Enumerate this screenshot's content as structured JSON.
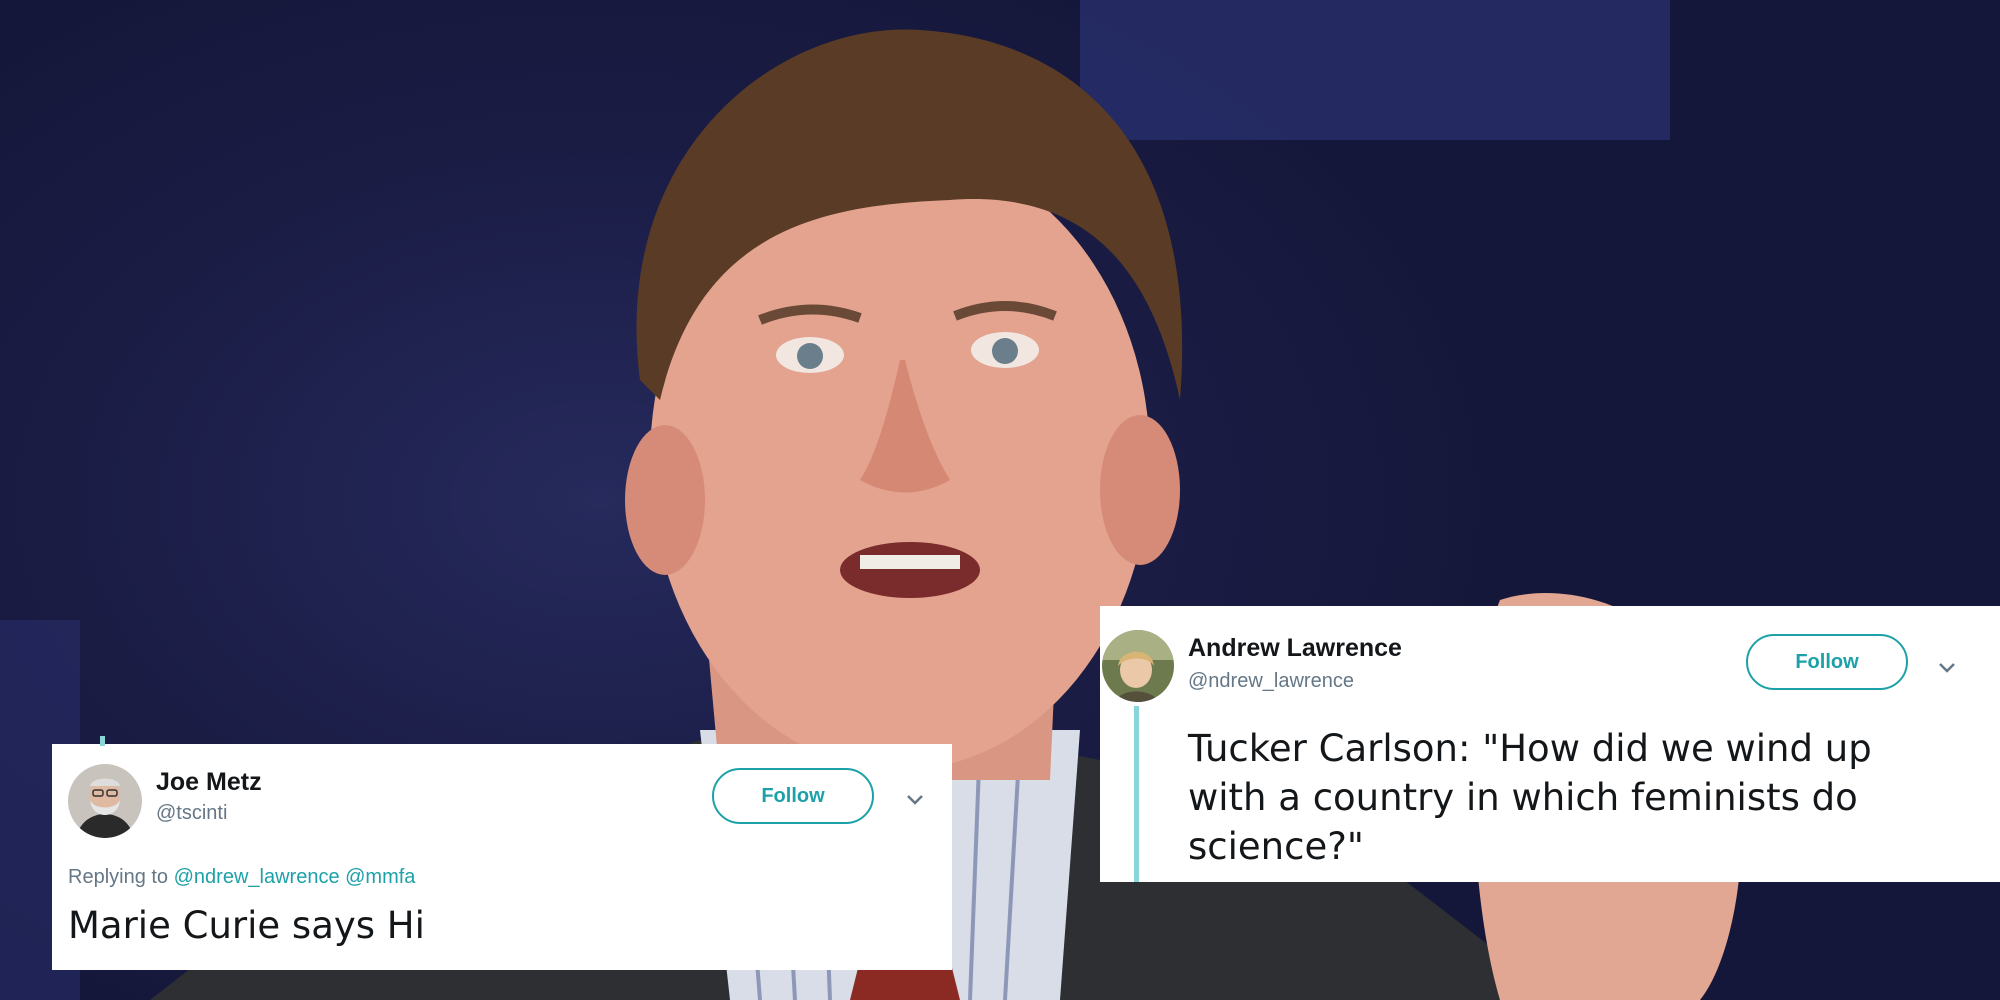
{
  "tweet_left": {
    "name": "Joe Metz",
    "handle": "@tscinti",
    "follow_label": "Follow",
    "replying_prefix": "Replying to",
    "replying_mentions": [
      "@ndrew_lawrence",
      "@mmfa"
    ],
    "text": "Marie Curie says Hi",
    "avatar_icon": "bearded-man-avatar"
  },
  "tweet_right": {
    "name": "Andrew Lawrence",
    "handle": "@ndrew_lawrence",
    "follow_label": "Follow",
    "text": "Tucker Carlson: \"How did we wind up with a country in which feminists do science?\"",
    "avatar_icon": "child-avatar"
  },
  "colors": {
    "accent": "#1da1a8",
    "background": "#1b1f45"
  }
}
